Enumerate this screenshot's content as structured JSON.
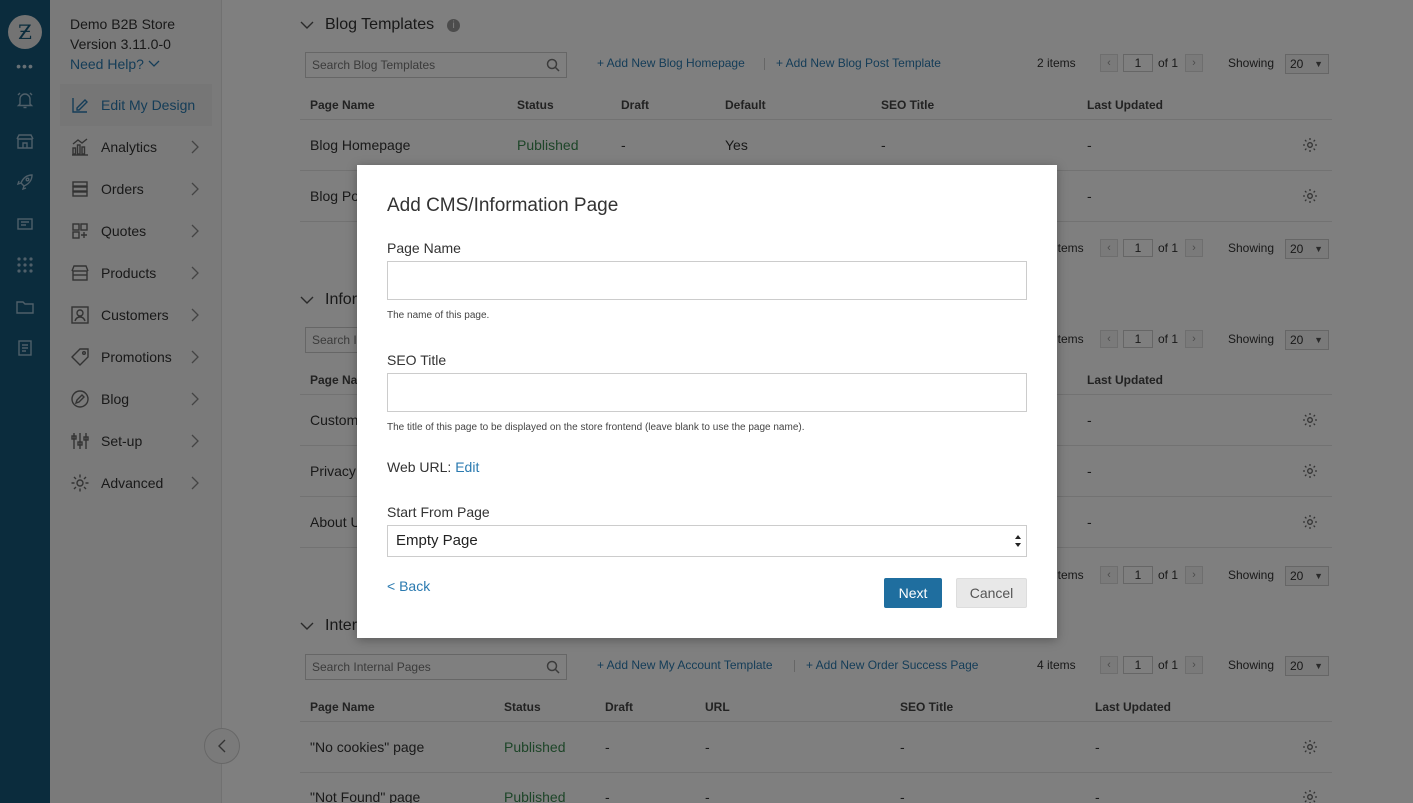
{
  "app": {
    "store_name": "Demo B2B Store",
    "version": "Version 3.11.0-0",
    "need_help": "Need Help?",
    "logo_glyph": "Ƶ",
    "rail_dots": "•••"
  },
  "sidebar": {
    "items": [
      {
        "label": "Edit My Design",
        "icon": "edit-design-icon"
      },
      {
        "label": "Analytics",
        "icon": "analytics-icon"
      },
      {
        "label": "Orders",
        "icon": "orders-icon"
      },
      {
        "label": "Quotes",
        "icon": "quotes-icon"
      },
      {
        "label": "Products",
        "icon": "products-icon"
      },
      {
        "label": "Customers",
        "icon": "customers-icon"
      },
      {
        "label": "Promotions",
        "icon": "promotions-icon"
      },
      {
        "label": "Blog",
        "icon": "blog-icon"
      },
      {
        "label": "Set-up",
        "icon": "setup-icon"
      },
      {
        "label": "Advanced",
        "icon": "advanced-icon"
      }
    ]
  },
  "blog_templates": {
    "title": "Blog Templates",
    "info": "i",
    "search_placeholder": "Search Blog Templates",
    "add_homepage": "+ Add New Blog Homepage",
    "add_post_template": "+ Add New Blog Post Template",
    "count": "2 items",
    "page": "1",
    "of": "of 1",
    "showing": "Showing",
    "show_value": "20",
    "columns": [
      "Page Name",
      "Status",
      "Draft",
      "Default",
      "SEO Title",
      "Last Updated"
    ],
    "rows": [
      {
        "name": "Blog Homepage",
        "status": "Published",
        "draft": "-",
        "default": "Yes",
        "seo": "-",
        "updated": "-"
      },
      {
        "name": "Blog Po",
        "updated": "-"
      }
    ],
    "bottom_count_partial": "items"
  },
  "info_pages": {
    "title_partial": "Infor",
    "search_partial": "Search I",
    "count_partial": "items",
    "columns": {
      "page_name_partial": "Page Na",
      "last_updated": "Last Updated"
    },
    "rows": [
      {
        "name": "Custom",
        "updated": "-"
      },
      {
        "name": "Privacy",
        "updated": "-"
      },
      {
        "name": "About U",
        "updated": "-"
      }
    ],
    "bottom_count_partial": "items"
  },
  "internal_pages": {
    "title_partial": "Inter",
    "search_placeholder": "Search Internal Pages",
    "add_account_template": "+ Add New My Account Template",
    "add_order_success": "+ Add New Order Success Page",
    "count": "4 items",
    "columns": [
      "Page Name",
      "Status",
      "Draft",
      "URL",
      "SEO Title",
      "Last Updated"
    ],
    "rows": [
      {
        "name": "\"No cookies\" page",
        "status": "Published",
        "draft": "-",
        "url": "-",
        "seo": "-",
        "updated": "-"
      },
      {
        "name": "\"Not Found\" page",
        "status": "Published",
        "draft": "-",
        "url": "-",
        "seo": "-",
        "updated": "-"
      }
    ]
  },
  "modal": {
    "title": "Add CMS/Information Page",
    "page_name_label": "Page Name",
    "page_name_value": "",
    "page_name_help": "The name of this page.",
    "seo_title_label": "SEO Title",
    "seo_title_value": "",
    "seo_title_help": "The title of this page to be displayed on the store frontend (leave blank to use the page name).",
    "web_url_label": "Web URL:",
    "web_url_edit": "Edit",
    "start_from_label": "Start From Page",
    "start_from_value": "Empty Page",
    "back": "< Back",
    "next": "Next",
    "cancel": "Cancel"
  },
  "colors": {
    "rail": "#17587a",
    "accent": "#2a7ab0",
    "published": "#3b8a50",
    "primary_button": "#1f6e9f"
  }
}
